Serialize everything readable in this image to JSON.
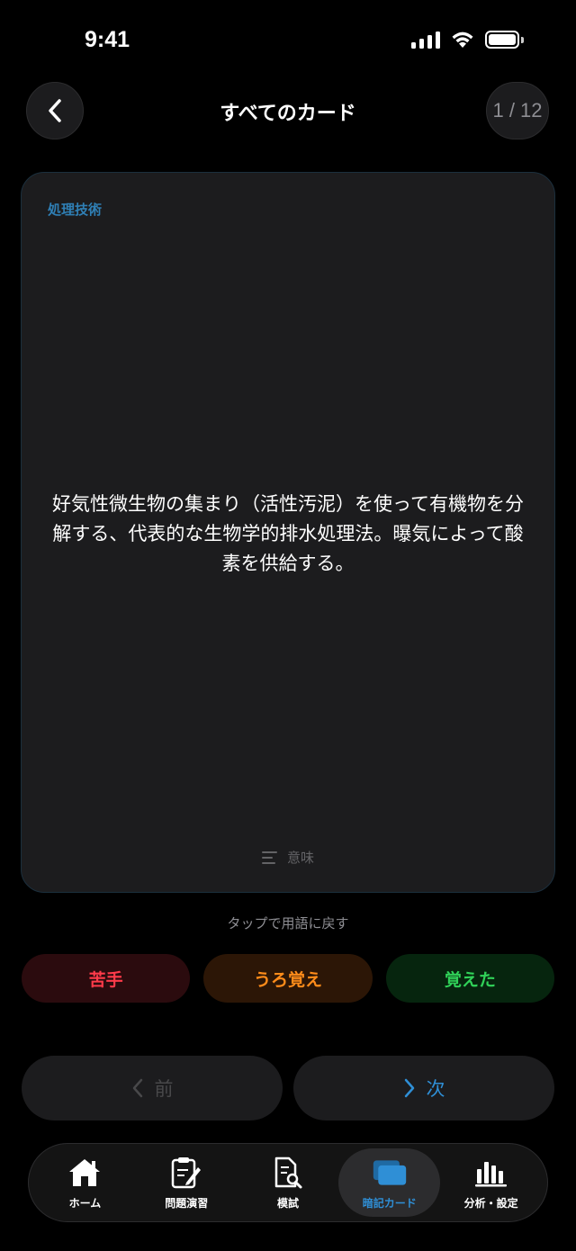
{
  "status_bar": {
    "time": "9:41"
  },
  "header": {
    "title": "すべてのカード",
    "counter": "1 / 12"
  },
  "card": {
    "category": "処理技術",
    "text": "好気性微生物の集まり（活性汚泥）を使って有機物を分解する、代表的な生物学的排水処理法。曝気によって酸素を供給する。",
    "side_label": "意味"
  },
  "tap_hint": "タップで用語に戻す",
  "rating": {
    "hard": "苦手",
    "vague": "うろ覚え",
    "known": "覚えた"
  },
  "navigation": {
    "prev": "前",
    "next": "次"
  },
  "tab_bar": {
    "items": [
      {
        "label": "ホーム",
        "icon": "home-icon"
      },
      {
        "label": "問題演習",
        "icon": "clipboard-edit-icon"
      },
      {
        "label": "模試",
        "icon": "document-search-icon"
      },
      {
        "label": "暗記カード",
        "icon": "cards-icon",
        "active": true
      },
      {
        "label": "分析・設定",
        "icon": "bar-chart-icon"
      }
    ]
  },
  "colors": {
    "accent": "#2f8fd6",
    "category": "#2f7fb5",
    "hard": "#ff3b4a",
    "vague": "#ff8c1a",
    "known": "#30d158"
  }
}
